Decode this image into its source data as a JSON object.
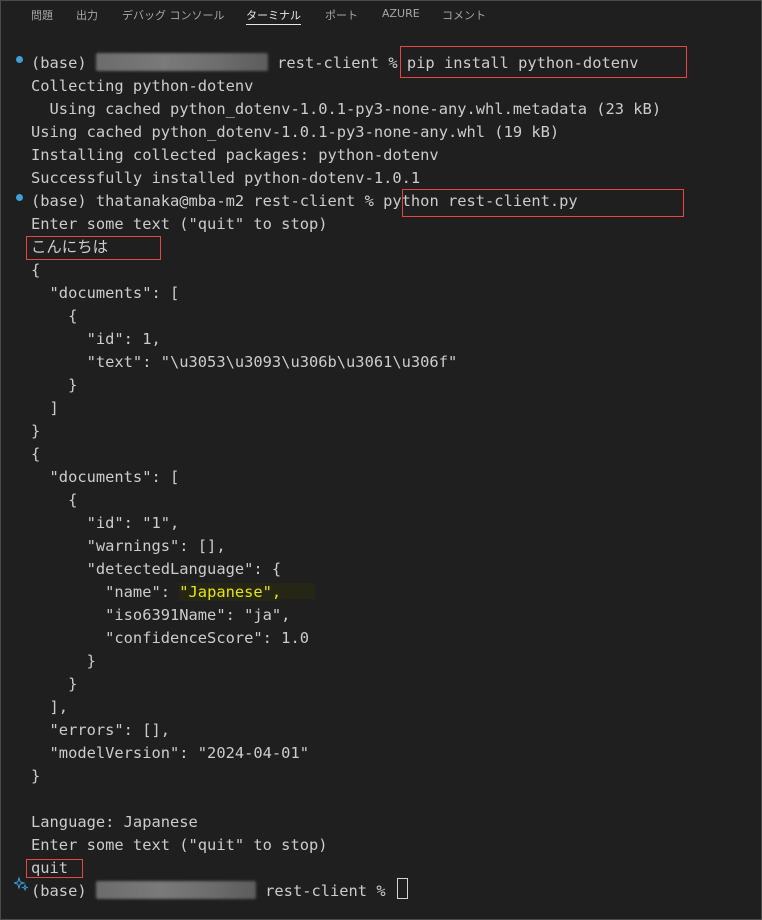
{
  "tabs": [
    "問題",
    "出力",
    "デバッグ コンソール",
    "ターミナル",
    "ポート",
    "AZURE",
    "コメント"
  ],
  "active_tab": "ターミナル",
  "terminal": {
    "l1_prefix": "(base) ",
    "l1_after": " rest-client % ",
    "l1_cmd": "pip install python-dotenv",
    "l2": "Collecting python-dotenv",
    "l3": "  Using cached python_dotenv-1.0.1-py3-none-any.whl.metadata (23 kB)",
    "l4": "Using cached python_dotenv-1.0.1-py3-none-any.whl (19 kB)",
    "l5": "Installing collected packages: python-dotenv",
    "l6": "Successfully installed python-dotenv-1.0.1",
    "l7_prompt": "(base) thatanaka@mba-m2 rest-client % ",
    "l7_cmd": "python rest-client.py",
    "l8": "Enter some text (\"quit\" to stop)",
    "l9": "こんにちは",
    "l10": "{",
    "l11": "  \"documents\": [",
    "l12": "    {",
    "l13": "      \"id\": 1,",
    "l14": "      \"text\": \"\\u3053\\u3093\\u306b\\u3061\\u306f\"",
    "l15": "    }",
    "l16": "  ]",
    "l17": "}",
    "l18": "{",
    "l19": "  \"documents\": [",
    "l20": "    {",
    "l21": "      \"id\": \"1\",",
    "l22": "      \"warnings\": [],",
    "l23": "      \"detectedLanguage\": {",
    "l24_pre": "        \"name\": ",
    "l24_val": "\"Japanese\",",
    "l25": "        \"iso6391Name\": \"ja\",",
    "l26": "        \"confidenceScore\": 1.0",
    "l27": "      }",
    "l28": "    }",
    "l29": "  ],",
    "l30": "  \"errors\": [],",
    "l31": "  \"modelVersion\": \"2024-04-01\"",
    "l32": "}",
    "l33": "Language: Japanese",
    "l34": "Enter some text (\"quit\" to stop)",
    "l35": "quit",
    "l36_prefix": "(base) ",
    "l36_after": " rest-client % "
  },
  "colors": {
    "background": "#1f1f1f",
    "text": "#cccccc",
    "highlight_red": "#e8463f",
    "prompt_dot": "#3f9fd6",
    "json_string_highlight": "#e5e510"
  }
}
